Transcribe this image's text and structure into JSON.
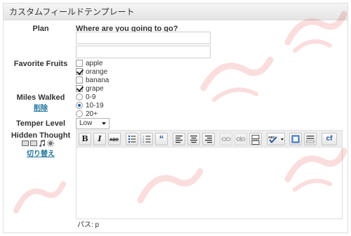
{
  "panel": {
    "title": "カスタムフィールドテンプレート"
  },
  "plan": {
    "label": "Plan",
    "question": "Where are you going to go?",
    "input1_value": "",
    "input2_value": ""
  },
  "fruits": {
    "label": "Favorite Fruits",
    "options": [
      {
        "label": "apple",
        "checked": false
      },
      {
        "label": "orange",
        "checked": true
      },
      {
        "label": "banana",
        "checked": false
      },
      {
        "label": "grape",
        "checked": true
      }
    ]
  },
  "miles": {
    "label": "Miles Walked",
    "delete_link": "削除",
    "options": [
      {
        "label": "0-9",
        "checked": false
      },
      {
        "label": "10-19",
        "checked": true
      },
      {
        "label": "20+",
        "checked": false
      }
    ]
  },
  "temper": {
    "label": "Temper Level",
    "selected": "Low"
  },
  "hidden": {
    "label": "Hidden Thought",
    "toggle_link": "切り替え",
    "path_text": "パス: p"
  },
  "toolbar": {
    "buttons": [
      "bold",
      "italic",
      "strikethrough",
      "bullet-list",
      "numbered-list",
      "blockquote",
      "align-left",
      "align-center",
      "align-right",
      "link",
      "unlink",
      "more",
      "spellcheck",
      "fullscreen",
      "kitchen-sink",
      "cforms"
    ],
    "bold_label": "B",
    "italic_label": "I",
    "blockquote_label": "“",
    "cforms_label": "cf"
  }
}
